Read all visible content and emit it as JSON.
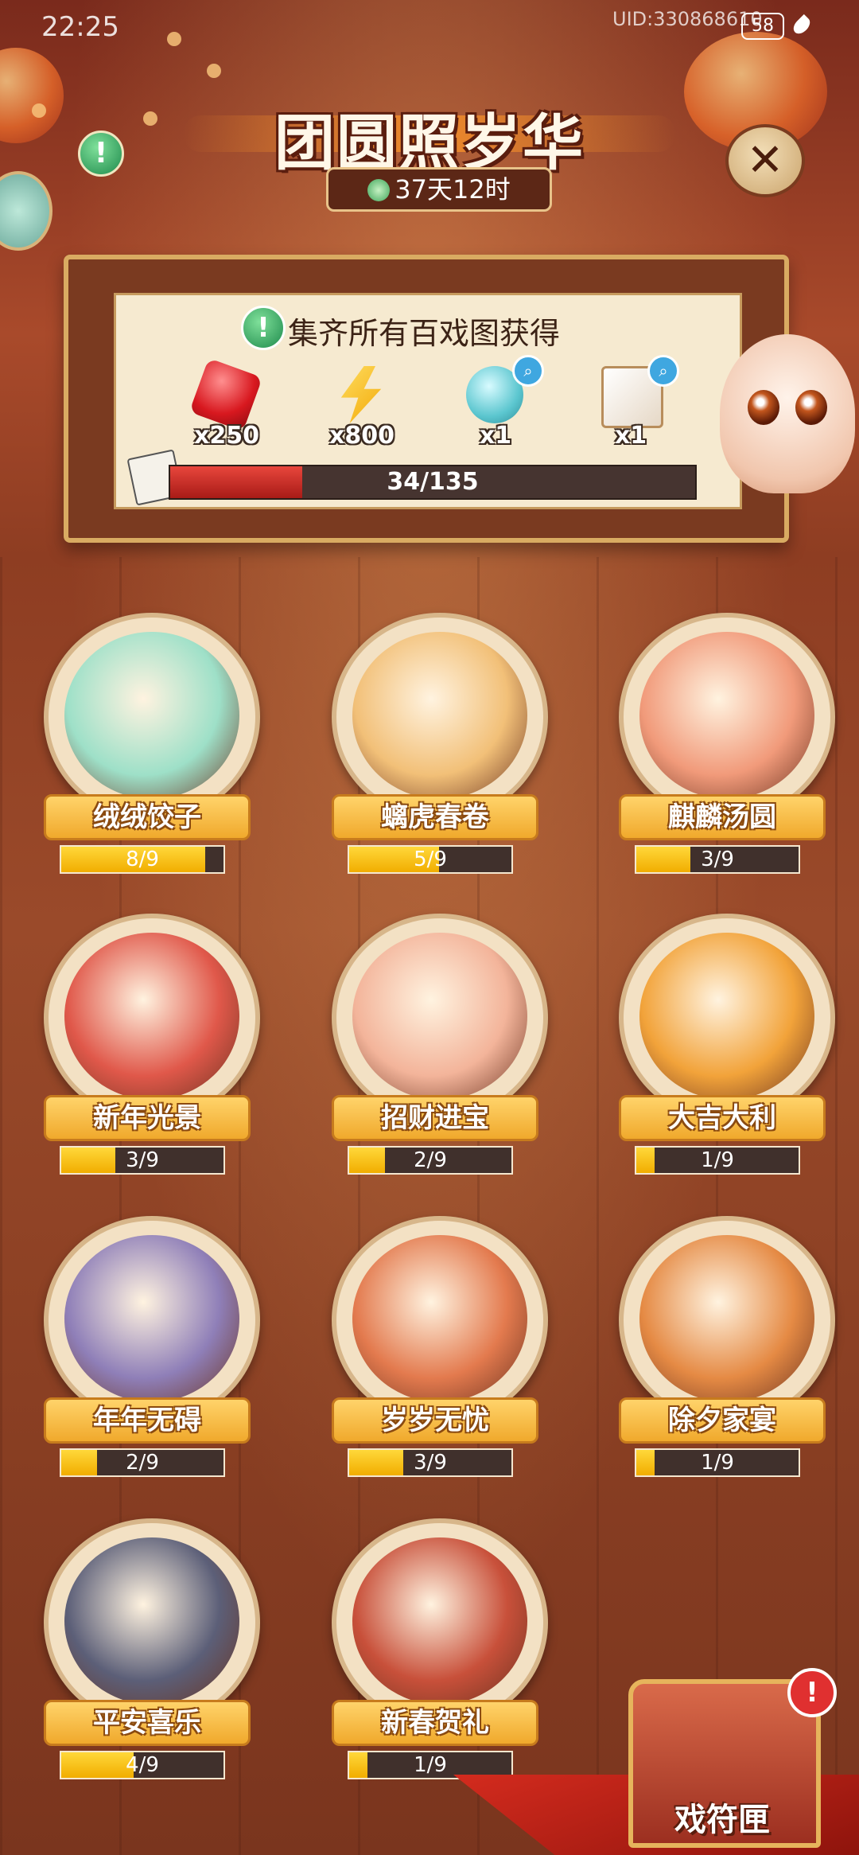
{
  "status_bar": {
    "time": "22:25",
    "uid": "UID:330868610",
    "battery": "58"
  },
  "event": {
    "title": "团圆照岁华",
    "timer": "37天12时"
  },
  "rewards_panel": {
    "heading": "集齐所有百戏图获得",
    "rewards": [
      {
        "icon": "red-gem-icon",
        "count": "x250"
      },
      {
        "icon": "lightning-bolt-icon",
        "count": "x800"
      },
      {
        "icon": "jade-spirit-icon",
        "count": "x1"
      },
      {
        "icon": "lion-dance-portrait-icon",
        "count": "x1"
      }
    ],
    "progress_text": "34/135",
    "progress_fraction": 0.252
  },
  "collections": [
    {
      "name": "绒绒饺子",
      "progress": "8/9",
      "fraction": 0.889,
      "art": "#9ee0c8"
    },
    {
      "name": "螭虎春卷",
      "progress": "5/9",
      "fraction": 0.556,
      "art": "#f2c078"
    },
    {
      "name": "麒麟汤圆",
      "progress": "3/9",
      "fraction": 0.333,
      "art": "#f19a7a"
    },
    {
      "name": "新年光景",
      "progress": "3/9",
      "fraction": 0.333,
      "art": "#e0584a"
    },
    {
      "name": "招财进宝",
      "progress": "2/9",
      "fraction": 0.222,
      "art": "#f3b49a"
    },
    {
      "name": "大吉大利",
      "progress": "1/9",
      "fraction": 0.111,
      "art": "#f2a33a"
    },
    {
      "name": "年年无碍",
      "progress": "2/9",
      "fraction": 0.222,
      "art": "#8f7fb8"
    },
    {
      "name": "岁岁无忧",
      "progress": "3/9",
      "fraction": 0.333,
      "art": "#e37a4e"
    },
    {
      "name": "除夕家宴",
      "progress": "1/9",
      "fraction": 0.111,
      "art": "#e58a44"
    },
    {
      "name": "平安喜乐",
      "progress": "4/9",
      "fraction": 0.444,
      "art": "#5c5f78"
    },
    {
      "name": "新春贺礼",
      "progress": "1/9",
      "fraction": 0.111,
      "art": "#c8503a"
    }
  ],
  "chest": {
    "label": "戏符匣",
    "badge": "!"
  }
}
